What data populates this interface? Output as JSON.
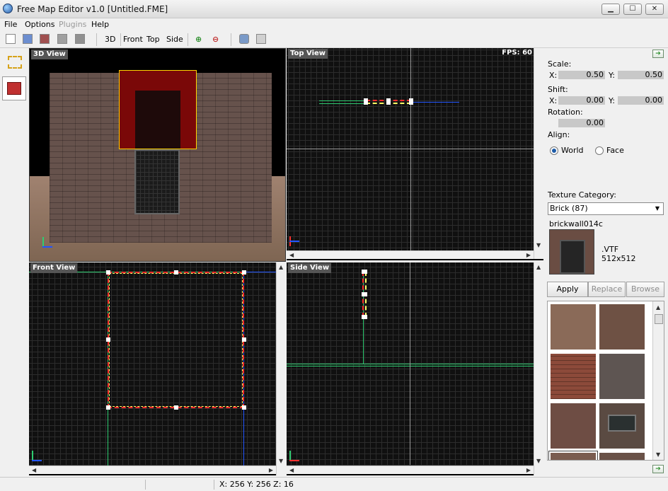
{
  "window": {
    "title": "Free Map Editor v1.0 [Untitled.FME]",
    "min": "▁",
    "max": "☐",
    "close": "✕"
  },
  "menu": [
    "File",
    "Options",
    "Plugins",
    "Help"
  ],
  "toolbar": {
    "btn_3d": "3D",
    "btn_front": "Front",
    "btn_top": "Top",
    "btn_side": "Side"
  },
  "viewports": {
    "v3d": {
      "label": "3D View"
    },
    "top": {
      "label": "Top View",
      "fps": "FPS: 60"
    },
    "front": {
      "label": "Front View"
    },
    "side": {
      "label": "Side View"
    }
  },
  "panel": {
    "scale_label": "Scale:",
    "scale_x_label": "X:",
    "scale_x": "0.50",
    "scale_y_label": "Y:",
    "scale_y": "0.50",
    "shift_label": "Shift:",
    "shift_x_label": "X:",
    "shift_x": "0.00",
    "shift_y_label": "Y:",
    "shift_y": "0.00",
    "rotation_label": "Rotation:",
    "rotation": "0.00",
    "align_label": "Align:",
    "align_world": "World",
    "align_face": "Face",
    "align_selected": "World",
    "texture_category_label": "Texture Category:",
    "texture_category": "Brick (87)",
    "texture_name": "brickwall014c",
    "texture_format": ".VTF",
    "texture_size": "512x512",
    "apply": "Apply",
    "replace": "Replace",
    "browse": "Browse"
  },
  "status": {
    "coords": "X: 256 Y: 256 Z: 16"
  },
  "colors": {
    "selection": "#ff2b2b",
    "handle": "#ffffff",
    "axis_green": "#2ecc71",
    "axis_blue": "#2255ff"
  }
}
